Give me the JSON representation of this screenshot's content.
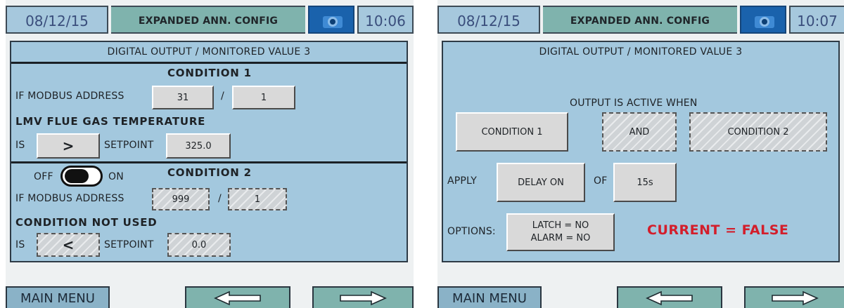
{
  "left": {
    "header": {
      "date": "08/12/15",
      "title": "EXPANDED ANN. CONFIG",
      "time": "10:06"
    },
    "page_title": "DIGITAL OUTPUT / MONITORED VALUE 3",
    "condition1": {
      "heading": "CONDITION 1",
      "modbus_label": "IF MODBUS ADDRESS",
      "address": "31",
      "slash": "/",
      "sub_address": "1",
      "value_name": "LMV FLUE GAS TEMPERATURE",
      "is_label": "IS",
      "operator": ">",
      "setpoint_label": "SETPOINT",
      "setpoint": "325.0"
    },
    "condition2": {
      "toggle_off": "OFF",
      "toggle_on": "ON",
      "toggle_state": "off",
      "heading": "CONDITION 2",
      "modbus_label": "IF MODBUS ADDRESS",
      "address": "999",
      "slash": "/",
      "sub_address": "1",
      "value_name": "CONDITION NOT USED",
      "is_label": "IS",
      "operator": "<",
      "setpoint_label": "SETPOINT",
      "setpoint": "0.0"
    },
    "footer": {
      "menu": "MAIN MENU"
    }
  },
  "right": {
    "header": {
      "date": "08/12/15",
      "title": "EXPANDED ANN. CONFIG",
      "time": "10:07"
    },
    "page_title": "DIGITAL OUTPUT / MONITORED VALUE 3",
    "output_label": "OUTPUT IS ACTIVE WHEN",
    "cond1": "CONDITION 1",
    "logic": "AND",
    "cond2": "CONDITION 2",
    "apply_label": "APPLY",
    "delay_mode": "DELAY ON",
    "of_label": "OF",
    "delay_value": "15s",
    "options_label": "OPTIONS:",
    "latch": "LATCH = NO",
    "alarm": "ALARM = NO",
    "current": "CURRENT = FALSE",
    "footer": {
      "menu": "MAIN MENU"
    }
  },
  "colors": {
    "panel": "#a3c8de",
    "header_title": "#7fb3ad",
    "camera": "#1a62ac",
    "alert_text": "#d31e2b"
  },
  "icons": {
    "camera": "camera-icon",
    "prev": "arrow-left-icon",
    "next": "arrow-right-icon"
  }
}
